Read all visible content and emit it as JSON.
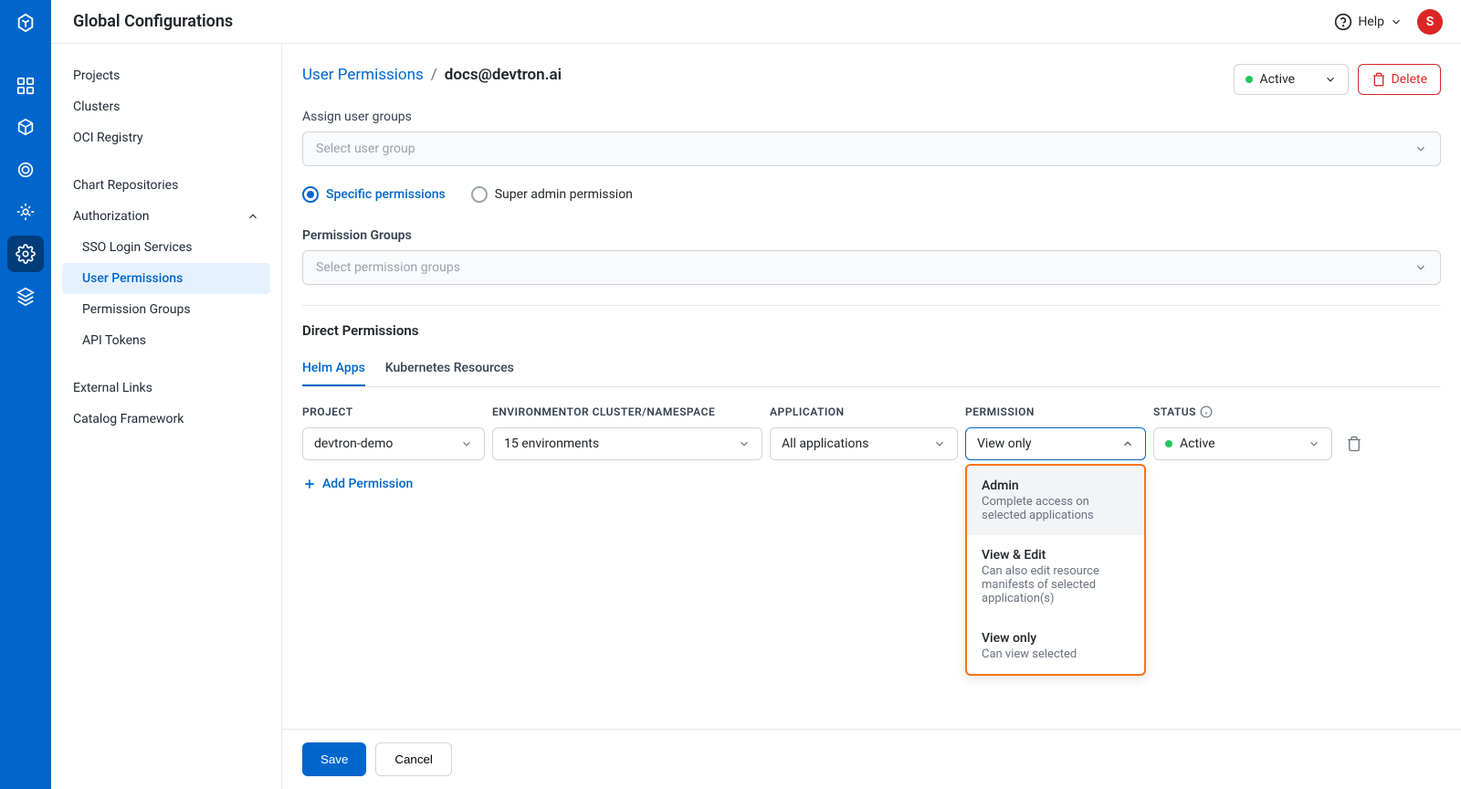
{
  "header": {
    "title": "Global Configurations",
    "help": "Help",
    "avatar": "S"
  },
  "sidebar": {
    "items": [
      "Projects",
      "Clusters",
      "OCI Registry"
    ],
    "chart": "Chart Repositories",
    "auth": {
      "label": "Authorization",
      "children": [
        "SSO Login Services",
        "User Permissions",
        "Permission Groups",
        "API Tokens"
      ]
    },
    "external": "External Links",
    "catalog": "Catalog Framework"
  },
  "breadcrumb": {
    "parent": "User Permissions",
    "current": "docs@devtron.ai"
  },
  "topActions": {
    "status": "Active",
    "delete": "Delete"
  },
  "assignGroups": {
    "label": "Assign user groups",
    "placeholder": "Select user group"
  },
  "radios": {
    "specific": "Specific permissions",
    "super": "Super admin permission"
  },
  "permGroups": {
    "label": "Permission Groups",
    "placeholder": "Select permission groups"
  },
  "direct": {
    "title": "Direct Permissions",
    "tabs": [
      "Helm Apps",
      "Kubernetes Resources"
    ],
    "columns": [
      "PROJECT",
      "ENVIRONMENTOR CLUSTER/NAMESPACE",
      "APPLICATION",
      "PERMISSION",
      "STATUS"
    ],
    "row": {
      "project": "devtron-demo",
      "env": "15 environments",
      "app": "All applications",
      "perm": "View only",
      "status": "Active"
    },
    "add": "Add Permission"
  },
  "dropdown": {
    "options": [
      {
        "title": "Admin",
        "desc": "Complete access on selected applications"
      },
      {
        "title": "View & Edit",
        "desc": "Can also edit resource manifests of selected application(s)"
      },
      {
        "title": "View only",
        "desc": "Can view selected"
      }
    ]
  },
  "footer": {
    "save": "Save",
    "cancel": "Cancel"
  }
}
